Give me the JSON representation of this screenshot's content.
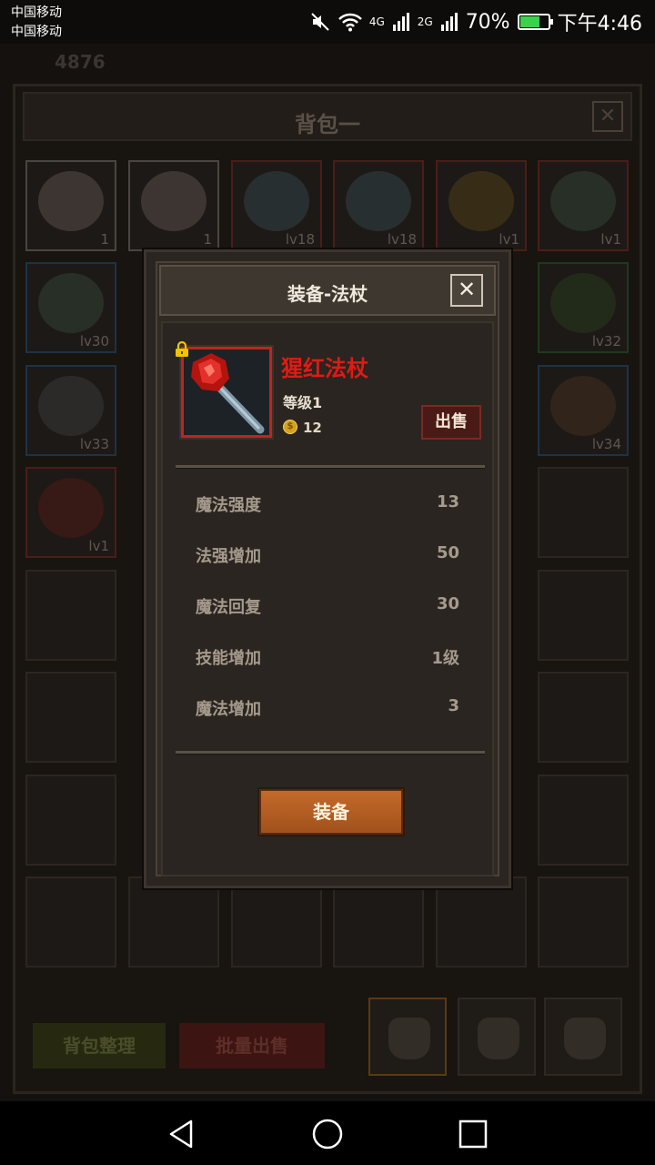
{
  "status_bar": {
    "carrier_1": "中国移动",
    "carrier_2": "中国移动",
    "network_1": "4G",
    "network_2": "2G",
    "battery": "70%",
    "battery_level": 0.7,
    "time": "下午4:46"
  },
  "background_hud": {
    "text": "4876"
  },
  "bag": {
    "title": "背包一",
    "close": "✕",
    "slots": [
      {
        "label": "1",
        "color": "gray"
      },
      {
        "label": "1",
        "color": "gray"
      },
      {
        "label": "lv18",
        "color": "red"
      },
      {
        "label": "lv18",
        "color": "red"
      },
      {
        "label": "lv1",
        "color": "red"
      },
      {
        "label": "lv1",
        "color": "red"
      },
      {
        "label": "lv30",
        "color": "blue"
      },
      {
        "label": "lv32",
        "color": "green"
      },
      {
        "label": "lv33",
        "color": "blue"
      },
      {
        "label": "lv34",
        "color": "blue"
      },
      {
        "label": "lv1",
        "color": "red"
      }
    ],
    "sort_button": "背包整理",
    "bulk_sell_button": "批量出售"
  },
  "modal": {
    "title": "装备-法杖",
    "close": "✕",
    "item": {
      "name": "猩红法杖",
      "level": "等级1",
      "coin_symbol": "$",
      "price": "12",
      "locked": true
    },
    "sell_button": "出售",
    "stats": [
      {
        "label": "魔法强度",
        "value": "13"
      },
      {
        "label": "法强增加",
        "value": "50"
      },
      {
        "label": "魔法回复",
        "value": "30"
      },
      {
        "label": "技能增加",
        "value": "1级"
      },
      {
        "label": "魔法增加",
        "value": "3"
      }
    ],
    "equip_button": "装备"
  },
  "colors": {
    "item_name": "#e01a14",
    "equip_button": "#b45d22",
    "sell_button": "#4a1a16"
  }
}
